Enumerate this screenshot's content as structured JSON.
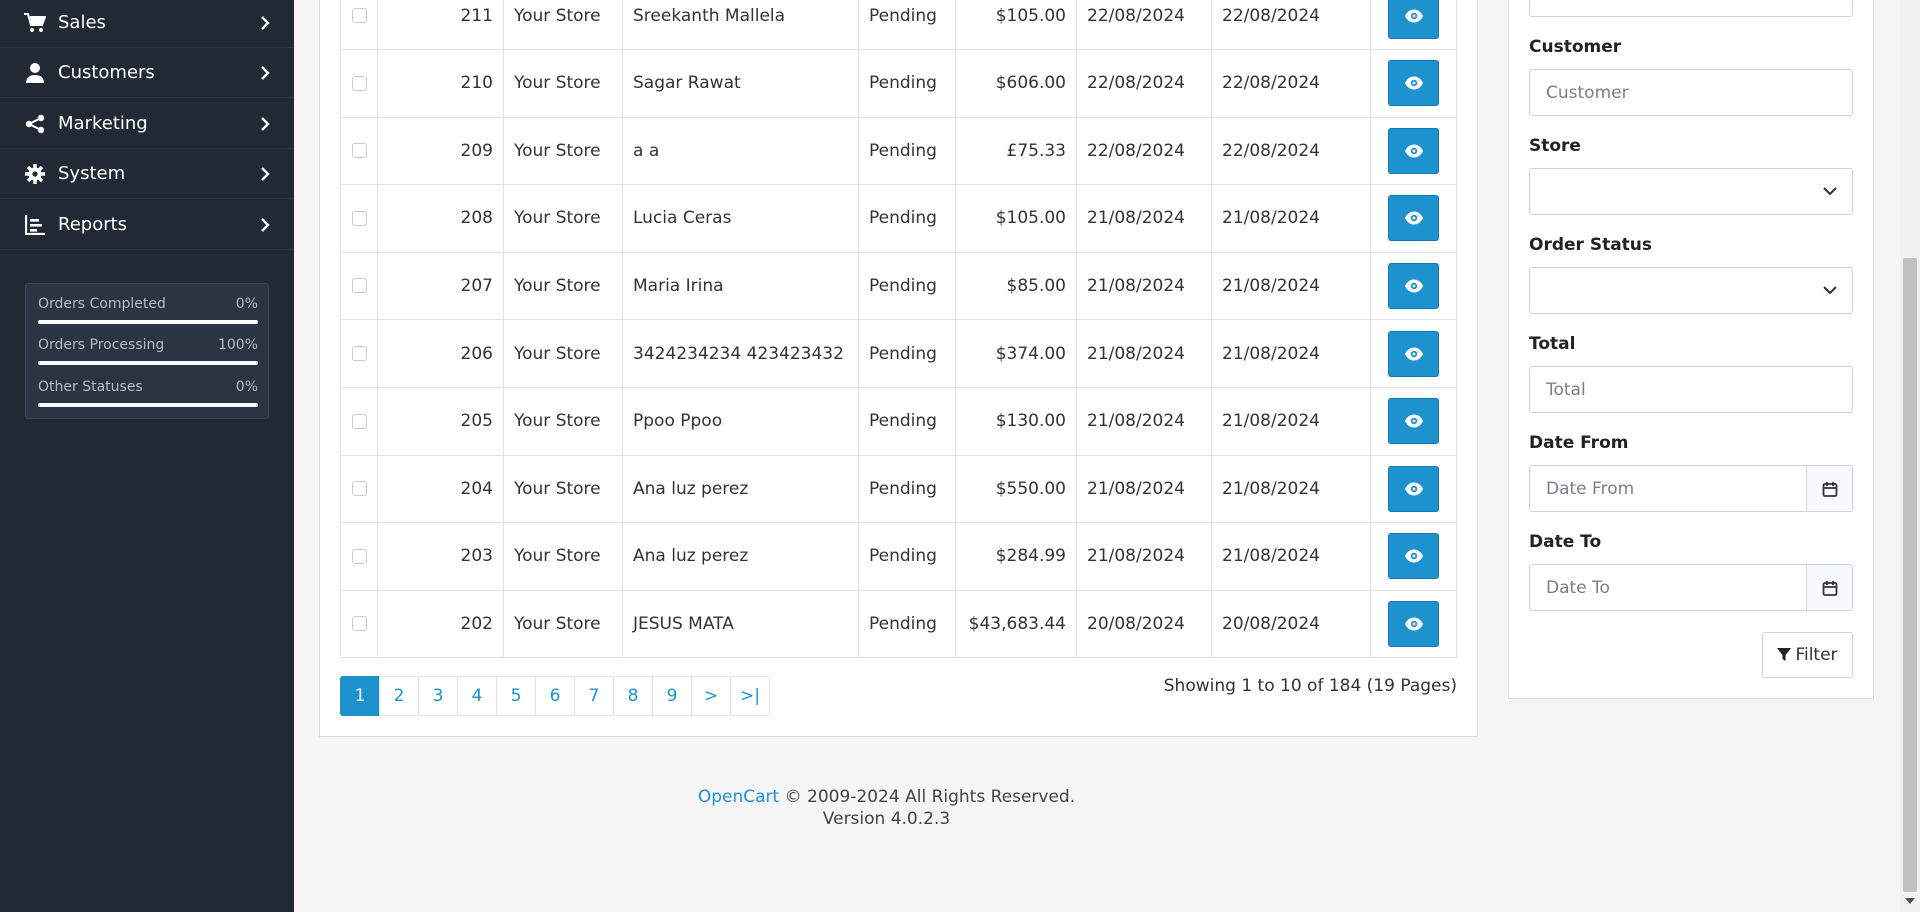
{
  "sidebar": {
    "items": [
      {
        "label": "Sales",
        "icon": "cart-icon"
      },
      {
        "label": "Customers",
        "icon": "user-icon"
      },
      {
        "label": "Marketing",
        "icon": "share-icon"
      },
      {
        "label": "System",
        "icon": "gear-icon"
      },
      {
        "label": "Reports",
        "icon": "bar-chart-icon"
      }
    ],
    "stats": [
      {
        "label": "Orders Completed",
        "value": "0%"
      },
      {
        "label": "Orders Processing",
        "value": "100%"
      },
      {
        "label": "Other Statuses",
        "value": "0%"
      }
    ]
  },
  "orders": [
    {
      "id": "211",
      "store": "Your Store",
      "customer": "Sreekanth Mallela",
      "status": "Pending",
      "total": "$105.00",
      "date_added": "22/08/2024",
      "date_modified": "22/08/2024"
    },
    {
      "id": "210",
      "store": "Your Store",
      "customer": "Sagar Rawat",
      "status": "Pending",
      "total": "$606.00",
      "date_added": "22/08/2024",
      "date_modified": "22/08/2024"
    },
    {
      "id": "209",
      "store": "Your Store",
      "customer": "a a",
      "status": "Pending",
      "total": "£75.33",
      "date_added": "22/08/2024",
      "date_modified": "22/08/2024"
    },
    {
      "id": "208",
      "store": "Your Store",
      "customer": "Lucia Ceras",
      "status": "Pending",
      "total": "$105.00",
      "date_added": "21/08/2024",
      "date_modified": "21/08/2024"
    },
    {
      "id": "207",
      "store": "Your Store",
      "customer": "Maria Irina",
      "status": "Pending",
      "total": "$85.00",
      "date_added": "21/08/2024",
      "date_modified": "21/08/2024"
    },
    {
      "id": "206",
      "store": "Your Store",
      "customer": "3424234234 423423432",
      "status": "Pending",
      "total": "$374.00",
      "date_added": "21/08/2024",
      "date_modified": "21/08/2024"
    },
    {
      "id": "205",
      "store": "Your Store",
      "customer": "Ppoo Ppoo",
      "status": "Pending",
      "total": "$130.00",
      "date_added": "21/08/2024",
      "date_modified": "21/08/2024"
    },
    {
      "id": "204",
      "store": "Your Store",
      "customer": "Ana luz perez",
      "status": "Pending",
      "total": "$550.00",
      "date_added": "21/08/2024",
      "date_modified": "21/08/2024"
    },
    {
      "id": "203",
      "store": "Your Store",
      "customer": "Ana luz perez",
      "status": "Pending",
      "total": "$284.99",
      "date_added": "21/08/2024",
      "date_modified": "21/08/2024"
    },
    {
      "id": "202",
      "store": "Your Store",
      "customer": "JESUS MATA",
      "status": "Pending",
      "total": "$43,683.44",
      "date_added": "20/08/2024",
      "date_modified": "20/08/2024"
    }
  ],
  "pagination": {
    "pages": [
      "1",
      "2",
      "3",
      "4",
      "5",
      "6",
      "7",
      "8",
      "9",
      ">",
      ">|"
    ],
    "active": "1",
    "results": "Showing 1 to 10 of 184 (19 Pages)"
  },
  "filter": {
    "customer_label": "Customer",
    "customer_placeholder": "Customer",
    "store_label": "Store",
    "store_value": "",
    "status_label": "Order Status",
    "status_value": "",
    "total_label": "Total",
    "total_placeholder": "Total",
    "date_from_label": "Date From",
    "date_from_placeholder": "Date From",
    "date_to_label": "Date To",
    "date_to_placeholder": "Date To",
    "button_label": "Filter"
  },
  "footer": {
    "brand": "OpenCart",
    "copyright": " © 2009-2024 All Rights Reserved.",
    "version": "Version 4.0.2.3"
  },
  "colors": {
    "sidebar_bg": "#212935",
    "primary": "#1e91cf"
  }
}
